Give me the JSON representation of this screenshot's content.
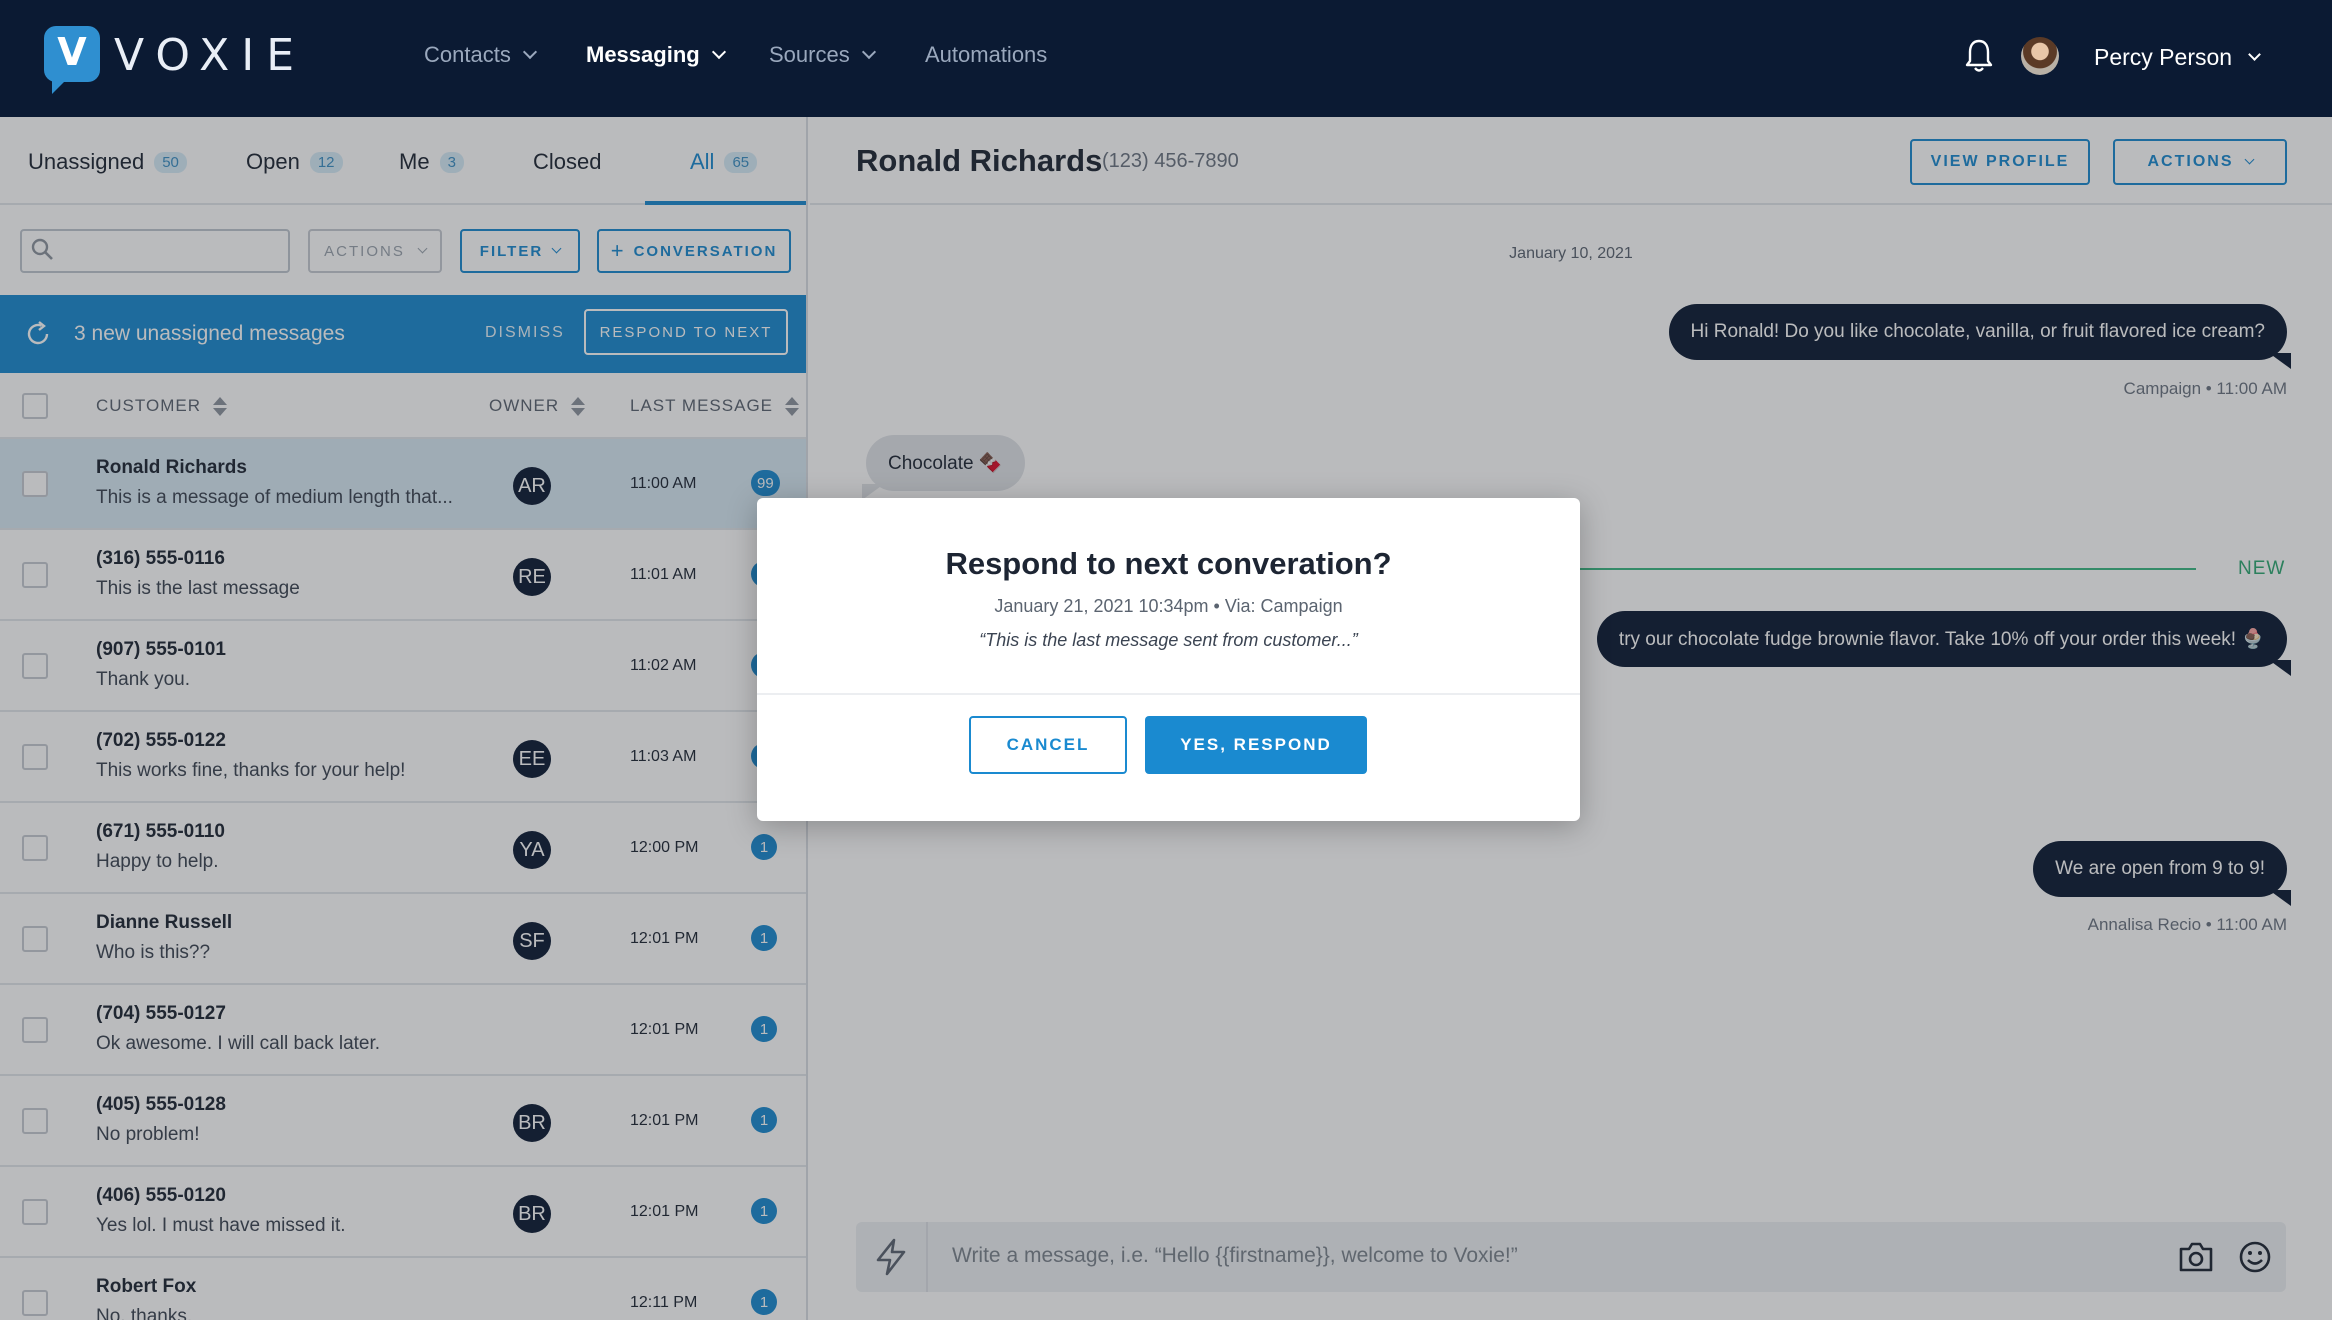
{
  "brand": {
    "name": "VOXIE",
    "accent": "#1a8ad0",
    "navy": "#0b1a33"
  },
  "nav": {
    "items": [
      {
        "label": "Contacts",
        "has_dropdown": true,
        "active": false
      },
      {
        "label": "Messaging",
        "has_dropdown": true,
        "active": true
      },
      {
        "label": "Sources",
        "has_dropdown": true,
        "active": false
      },
      {
        "label": "Automations",
        "has_dropdown": false,
        "active": false
      }
    ],
    "user_name": "Percy Person"
  },
  "tabs": [
    {
      "label": "Unassigned",
      "count": "50"
    },
    {
      "label": "Open",
      "count": "12"
    },
    {
      "label": "Me",
      "count": "3"
    },
    {
      "label": "Closed",
      "count": ""
    },
    {
      "label": "All",
      "count": "65",
      "active": true
    }
  ],
  "toolbar": {
    "search_placeholder": "",
    "actions_label": "ACTIONS",
    "filter_label": "FILTER",
    "conversation_label": "CONVERSATION"
  },
  "banner": {
    "text": "3 new unassigned messages",
    "dismiss_label": "DISMISS",
    "respond_label": "RESPOND TO NEXT"
  },
  "table": {
    "headers": {
      "customer": "CUSTOMER",
      "owner": "OWNER",
      "last_message": "LAST MESSAGE"
    },
    "rows": [
      {
        "name": "Ronald Richards",
        "message": "This is a message of medium length that...",
        "owner": "AR",
        "time": "11:00 AM",
        "count": "99",
        "selected": true
      },
      {
        "name": "(316) 555-0116",
        "message": "This is the last message",
        "owner": "RE",
        "time": "11:01 AM",
        "count": ""
      },
      {
        "name": "(907) 555-0101",
        "message": "Thank you.",
        "owner": "",
        "time": "11:02 AM",
        "count": ""
      },
      {
        "name": "(702) 555-0122",
        "message": "This works fine, thanks for your help!",
        "owner": "EE",
        "time": "11:03 AM",
        "count": ""
      },
      {
        "name": "(671) 555-0110",
        "message": "Happy to help.",
        "owner": "YA",
        "time": "12:00 PM",
        "count": "1"
      },
      {
        "name": "Dianne Russell",
        "message": "Who is this??",
        "owner": "SF",
        "time": "12:01 PM",
        "count": "1"
      },
      {
        "name": "(704) 555-0127",
        "message": "Ok awesome. I will call back later.",
        "owner": "",
        "time": "12:01 PM",
        "count": "1"
      },
      {
        "name": "(405) 555-0128",
        "message": "No problem!",
        "owner": "BR",
        "time": "12:01 PM",
        "count": "1"
      },
      {
        "name": "(406) 555-0120",
        "message": "Yes lol. I must have missed it.",
        "owner": "BR",
        "time": "12:01 PM",
        "count": "1"
      },
      {
        "name": "Robert Fox",
        "message": "No, thanks.",
        "owner": "",
        "time": "12:11 PM",
        "count": "1"
      }
    ]
  },
  "chat": {
    "contact_name": "Ronald Richards",
    "contact_phone": "(123) 456-7890",
    "view_profile_label": "VIEW PROFILE",
    "actions_label": "ACTIONS",
    "date_separator": "January 10, 2021",
    "messages": {
      "m1": {
        "text": "Hi Ronald! Do you like chocolate, vanilla, or fruit flavored ice cream?",
        "meta": "Campaign • 11:00 AM"
      },
      "m2": {
        "text": "Chocolate 🍫"
      },
      "m3": {
        "text": "try our chocolate fudge brownie flavor. Take 10% off your order this week! 🍨"
      },
      "m4": {
        "text": "We are open from 9 to 9!",
        "meta": "Annalisa Recio • 11:00 AM"
      }
    },
    "new_label": "NEW",
    "composer_placeholder": "Write a message, i.e. “Hello {{firstname}}, welcome to Voxie!”"
  },
  "modal": {
    "title": "Respond to next converation?",
    "meta": "January 21, 2021 10:34pm • Via: Campaign",
    "quote": "“This is the last message sent from customer...”",
    "cancel_label": "CANCEL",
    "confirm_label": "YES, RESPOND"
  }
}
